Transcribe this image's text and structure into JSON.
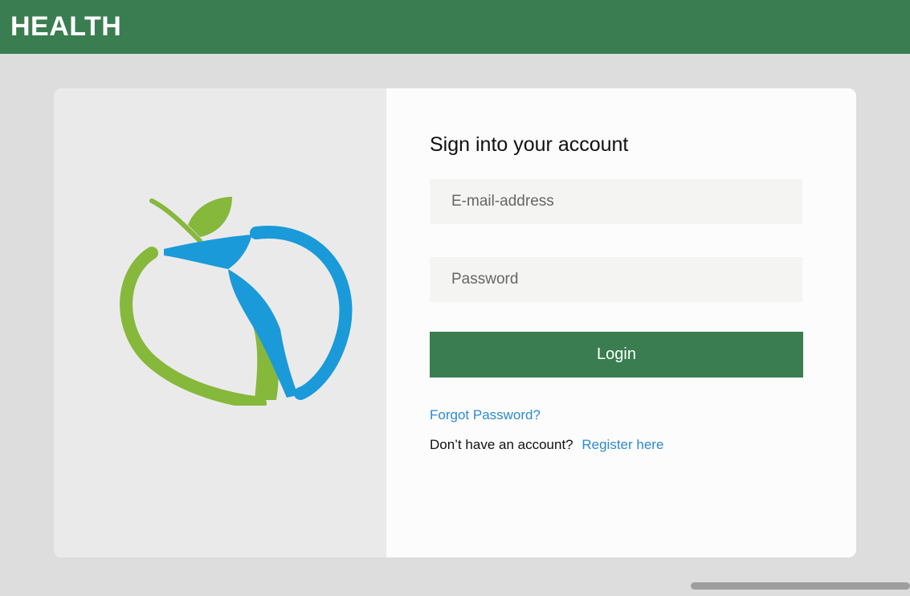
{
  "header": {
    "brand": "HEALTH",
    "color": "#3a7d50"
  },
  "logo": {
    "icon": "apple-person-logo-icon",
    "colors": {
      "green": "#86b83c",
      "blue": "#1a9ad8"
    }
  },
  "login": {
    "title": "Sign into your account",
    "email_placeholder": "E-mail-address",
    "email_value": "",
    "password_placeholder": "Password",
    "password_value": "",
    "button_label": "Login",
    "forgot_label": "Forgot Password?",
    "no_account_text": "Don’t have an account?",
    "register_label": "Register here",
    "link_color": "#2e8ad0"
  }
}
